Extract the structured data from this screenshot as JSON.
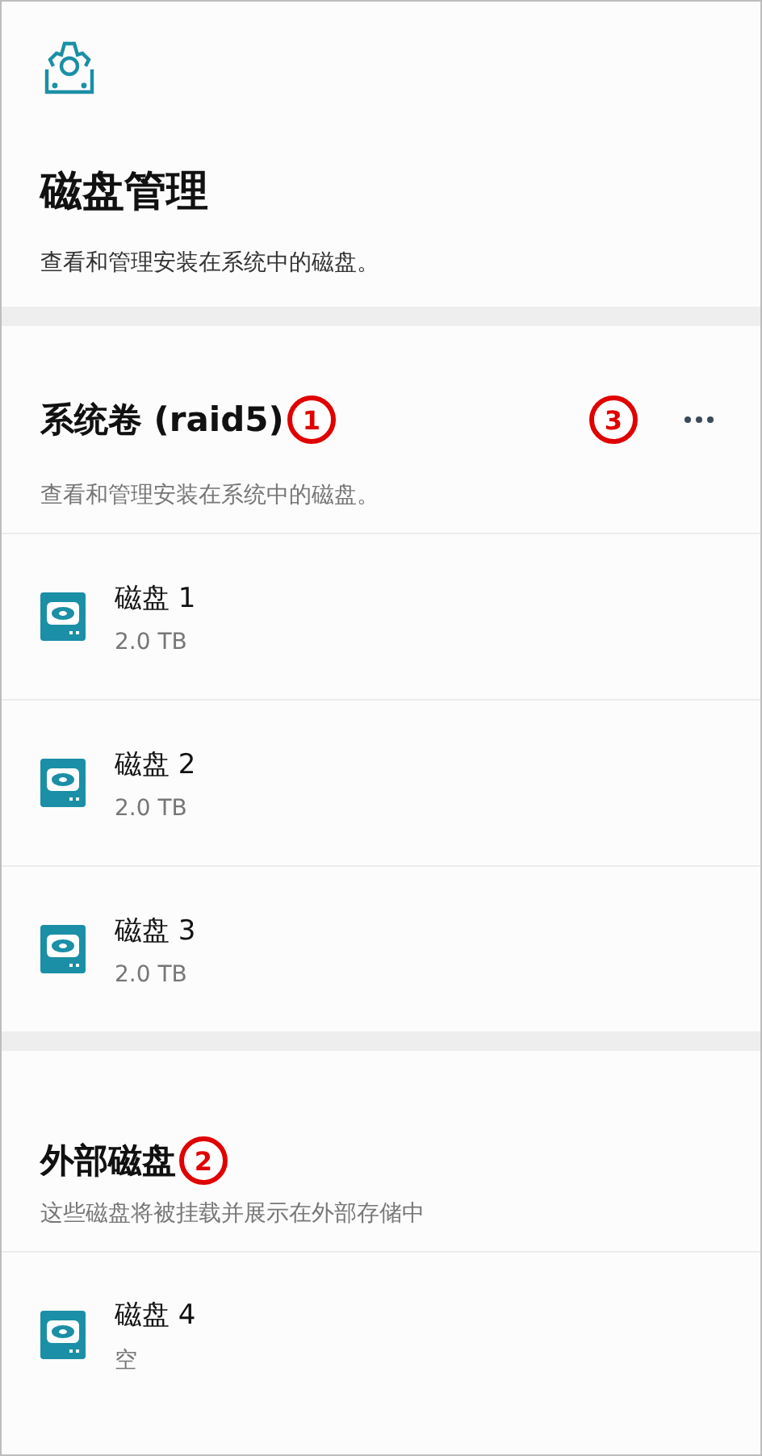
{
  "header": {
    "title": "磁盘管理",
    "description": "查看和管理安装在系统中的磁盘。"
  },
  "sections": [
    {
      "title": "系统卷 (raid5)",
      "description": "查看和管理安装在系统中的磁盘。",
      "has_menu": true,
      "callouts": [
        {
          "label": "1",
          "kind": "title"
        },
        {
          "label": "3",
          "kind": "menu"
        }
      ],
      "disks": [
        {
          "name": "磁盘 1",
          "size": "2.0 TB"
        },
        {
          "name": "磁盘 2",
          "size": "2.0 TB"
        },
        {
          "name": "磁盘 3",
          "size": "2.0 TB"
        }
      ]
    },
    {
      "title": "外部磁盘",
      "description": "这些磁盘将被挂载并展示在外部存储中",
      "has_menu": false,
      "callouts": [
        {
          "label": "2",
          "kind": "title"
        }
      ],
      "disks": [
        {
          "name": "磁盘 4",
          "size": "空"
        }
      ]
    }
  ]
}
